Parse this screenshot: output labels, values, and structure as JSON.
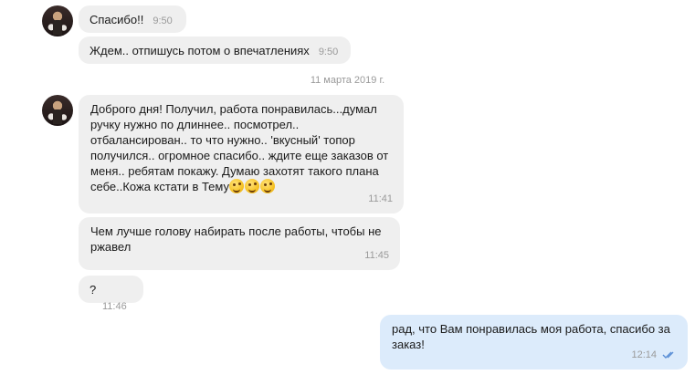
{
  "messages": [
    {
      "text": "Спасибо!!",
      "time": "9:50"
    },
    {
      "text": "Ждем.. отпишусь потом о впечатлениях",
      "time": "9:50"
    },
    {
      "text": "Доброго дня! Получил, работа понравилась...думал ручку нужно по длиннее.. посмотрел.. отбалансирован.. то что нужно.. 'вкусный' топор получился.. огромное спасибо.. ждите еще заказов от меня.. ребятам покажу. Думаю захотят такого плана себе..Кожа кстати в Тему",
      "time": "11:41",
      "emoji_icon": "winking-face-tongue-icon"
    },
    {
      "text": "Чем лучше голову набирать после работы, чтобы не ржавел",
      "time": "11:45"
    },
    {
      "text": "?",
      "time": "11:46"
    },
    {
      "text": "рад, что Вам понравилась моя работа, спасибо за заказ!",
      "time": "12:14",
      "status_icon": "double-check-icon"
    }
  ],
  "date_separator": "11 марта 2019 г.",
  "colors": {
    "incoming_bubble": "#efefef",
    "outgoing_bubble": "#dcebfb",
    "time": "#9a9a9a",
    "read_check": "#5b8fd6"
  }
}
